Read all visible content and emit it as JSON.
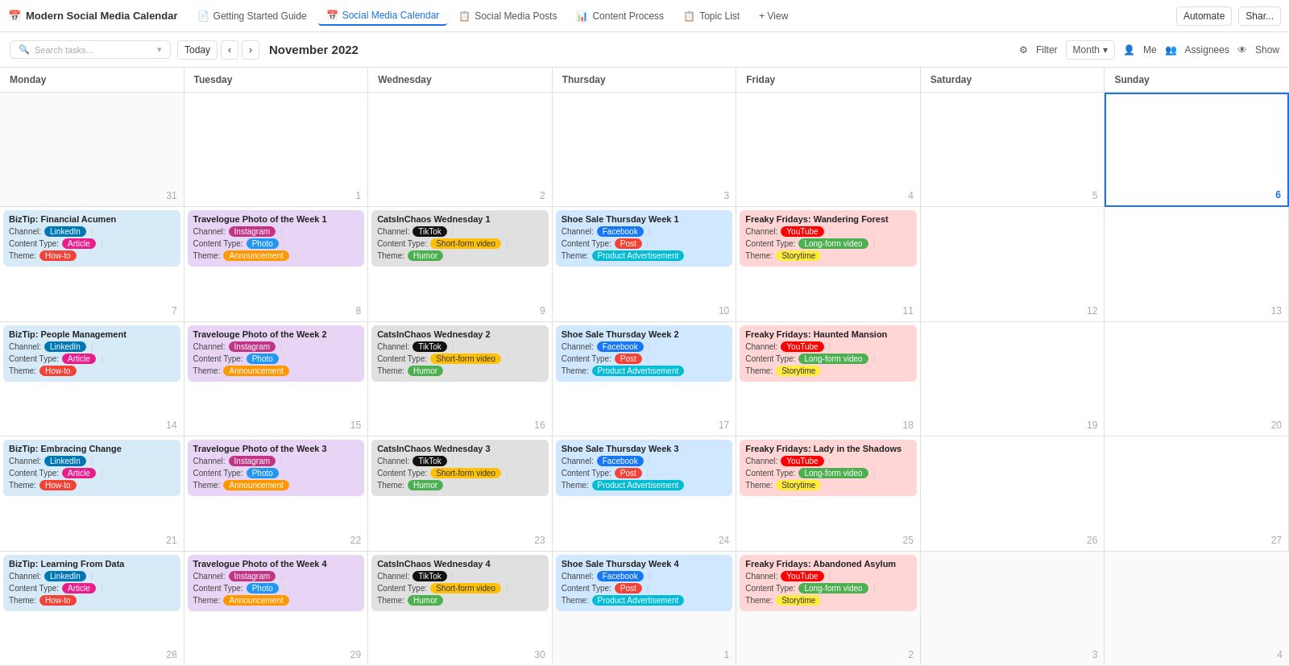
{
  "app": {
    "title": "Modern Social Media Calendar",
    "logo": "📅"
  },
  "nav": {
    "tabs": [
      {
        "id": "getting-started",
        "label": "Getting Started Guide",
        "icon": "📄"
      },
      {
        "id": "social-media-calendar",
        "label": "Social Media Calendar",
        "icon": "📅",
        "active": true
      },
      {
        "id": "social-media-posts",
        "label": "Social Media Posts",
        "icon": "📋"
      },
      {
        "id": "content-process",
        "label": "Content Process",
        "icon": "📊"
      },
      {
        "id": "topic-list",
        "label": "Topic List",
        "icon": "📋"
      }
    ],
    "view": "+ View",
    "automate": "Automate",
    "share": "Shar..."
  },
  "toolbar": {
    "search_placeholder": "Search tasks...",
    "today_btn": "Today",
    "month": "November 2022",
    "filter": "Filter",
    "view_mode": "Month",
    "me": "Me",
    "assignees": "Assignees",
    "show": "Show"
  },
  "calendar": {
    "days": [
      "Monday",
      "Tuesday",
      "Wednesday",
      "Thursday",
      "Friday",
      "Saturday",
      "Sunday"
    ],
    "rows": [
      {
        "cells": [
          {
            "date": "31",
            "other": true,
            "tasks": []
          },
          {
            "date": "1",
            "tasks": []
          },
          {
            "date": "2",
            "tasks": []
          },
          {
            "date": "3",
            "tasks": []
          },
          {
            "date": "4",
            "tasks": []
          },
          {
            "date": "5",
            "tasks": []
          },
          {
            "date": "6",
            "highlight": true,
            "tasks": []
          }
        ]
      },
      {
        "cells": [
          {
            "date": "7",
            "tasks": [
              {
                "title": "BizTip: Financial Acumen",
                "bg": "bg-blue",
                "channel_label": "Channel:",
                "channel_tag": "LinkedIn",
                "channel_class": "linkedin",
                "content_label": "Content Type:",
                "content_tag": "Article",
                "content_class": "article",
                "theme_label": "Theme:",
                "theme_tag": "How-to",
                "theme_class": "howto"
              }
            ]
          },
          {
            "date": "8",
            "tasks": [
              {
                "title": "Travelogue Photo of the Week 1",
                "bg": "bg-purple",
                "channel_label": "Channel:",
                "channel_tag": "Instagram",
                "channel_class": "instagram",
                "content_label": "Content Type:",
                "content_tag": "Photo",
                "content_class": "photo",
                "theme_label": "Theme:",
                "theme_tag": "Announcement",
                "theme_class": "announcement"
              }
            ]
          },
          {
            "date": "9",
            "tasks": [
              {
                "title": "CatsInChaos Wednesday 1",
                "bg": "bg-gray",
                "channel_label": "Channel:",
                "channel_tag": "TikTok",
                "channel_class": "tiktok",
                "content_label": "Content Type:",
                "content_tag": "Short-form video",
                "content_class": "short-video",
                "theme_label": "Theme:",
                "theme_tag": "Humor",
                "theme_class": "humor"
              }
            ]
          },
          {
            "date": "10",
            "tasks": [
              {
                "title": "Shoe Sale Thursday Week 1",
                "bg": "bg-blue2",
                "channel_label": "Channel:",
                "channel_tag": "Facebook",
                "channel_class": "facebook",
                "content_label": "Content Type:",
                "content_tag": "Post",
                "content_class": "post",
                "theme_label": "Theme:",
                "theme_tag": "Product Advertisement",
                "theme_class": "product-ad"
              }
            ]
          },
          {
            "date": "11",
            "tasks": [
              {
                "title": "Freaky Fridays: Wandering Forest",
                "bg": "bg-red",
                "channel_label": "Channel:",
                "channel_tag": "YouTube",
                "channel_class": "youtube",
                "content_label": "Content Type:",
                "content_tag": "Long-form video",
                "content_class": "long-video",
                "theme_label": "Theme:",
                "theme_tag": "Storytime",
                "theme_class": "storytime"
              }
            ]
          },
          {
            "date": "12",
            "tasks": []
          },
          {
            "date": "13",
            "tasks": []
          }
        ]
      },
      {
        "cells": [
          {
            "date": "14",
            "tasks": [
              {
                "title": "BizTip: People Management",
                "bg": "bg-blue",
                "channel_label": "Channel:",
                "channel_tag": "LinkedIn",
                "channel_class": "linkedin",
                "content_label": "Content Type:",
                "content_tag": "Article",
                "content_class": "article",
                "theme_label": "Theme:",
                "theme_tag": "How-to",
                "theme_class": "howto"
              }
            ]
          },
          {
            "date": "15",
            "tasks": [
              {
                "title": "Travelouge Photo of the Week 2",
                "bg": "bg-purple",
                "channel_label": "Channel:",
                "channel_tag": "Instagram",
                "channel_class": "instagram",
                "content_label": "Content Type:",
                "content_tag": "Photo",
                "content_class": "photo",
                "theme_label": "Theme:",
                "theme_tag": "Announcement",
                "theme_class": "announcement"
              }
            ]
          },
          {
            "date": "16",
            "tasks": [
              {
                "title": "CatsInChaos Wednesday 2",
                "bg": "bg-gray",
                "channel_label": "Channel:",
                "channel_tag": "TikTok",
                "channel_class": "tiktok",
                "content_label": "Content Type:",
                "content_tag": "Short-form video",
                "content_class": "short-video",
                "theme_label": "Theme:",
                "theme_tag": "Humor",
                "theme_class": "humor"
              }
            ]
          },
          {
            "date": "17",
            "tasks": [
              {
                "title": "Shoe Sale Thursday Week 2",
                "bg": "bg-blue2",
                "channel_label": "Channel:",
                "channel_tag": "Facebook",
                "channel_class": "facebook",
                "content_label": "Content Type:",
                "content_tag": "Post",
                "content_class": "post",
                "theme_label": "Theme:",
                "theme_tag": "Product Advertisement",
                "theme_class": "product-ad"
              }
            ]
          },
          {
            "date": "18",
            "tasks": [
              {
                "title": "Freaky Fridays: Haunted Mansion",
                "bg": "bg-red",
                "channel_label": "Channel:",
                "channel_tag": "YouTube",
                "channel_class": "youtube",
                "content_label": "Content Type:",
                "content_tag": "Long-form video",
                "content_class": "long-video",
                "theme_label": "Theme:",
                "theme_tag": "Storytime",
                "theme_class": "storytime"
              }
            ]
          },
          {
            "date": "19",
            "tasks": []
          },
          {
            "date": "20",
            "tasks": []
          }
        ]
      },
      {
        "cells": [
          {
            "date": "21",
            "tasks": [
              {
                "title": "BizTip: Embracing Change",
                "bg": "bg-blue",
                "channel_label": "Channel:",
                "channel_tag": "LinkedIn",
                "channel_class": "linkedin",
                "content_label": "Content Type:",
                "content_tag": "Article",
                "content_class": "article",
                "theme_label": "Theme:",
                "theme_tag": "How-to",
                "theme_class": "howto"
              }
            ]
          },
          {
            "date": "22",
            "tasks": [
              {
                "title": "Travelogue Photo of the Week 3",
                "bg": "bg-purple",
                "channel_label": "Channel:",
                "channel_tag": "Instagram",
                "channel_class": "instagram",
                "content_label": "Content Type:",
                "content_tag": "Photo",
                "content_class": "photo",
                "theme_label": "Theme:",
                "theme_tag": "Announcement",
                "theme_class": "announcement"
              }
            ]
          },
          {
            "date": "23",
            "tasks": [
              {
                "title": "CatsInChaos Wednesday 3",
                "bg": "bg-gray",
                "channel_label": "Channel:",
                "channel_tag": "TikTok",
                "channel_class": "tiktok",
                "content_label": "Content Type:",
                "content_tag": "Short-form video",
                "content_class": "short-video",
                "theme_label": "Theme:",
                "theme_tag": "Humor",
                "theme_class": "humor"
              }
            ]
          },
          {
            "date": "24",
            "tasks": [
              {
                "title": "Shoe Sale Thursday Week 3",
                "bg": "bg-blue2",
                "channel_label": "Channel:",
                "channel_tag": "Facebook",
                "channel_class": "facebook",
                "content_label": "Content Type:",
                "content_tag": "Post",
                "content_class": "post",
                "theme_label": "Theme:",
                "theme_tag": "Product Advertisement",
                "theme_class": "product-ad"
              }
            ]
          },
          {
            "date": "25",
            "tasks": [
              {
                "title": "Freaky Fridays: Lady in the Shadows",
                "bg": "bg-red",
                "channel_label": "Channel:",
                "channel_tag": "YouTube",
                "channel_class": "youtube",
                "content_label": "Content Type:",
                "content_tag": "Long-form video",
                "content_class": "long-video",
                "theme_label": "Theme:",
                "theme_tag": "Storytime",
                "theme_class": "storytime"
              }
            ]
          },
          {
            "date": "26",
            "tasks": []
          },
          {
            "date": "27",
            "tasks": []
          }
        ]
      },
      {
        "cells": [
          {
            "date": "28",
            "tasks": [
              {
                "title": "BizTip: Learning From Data",
                "bg": "bg-blue",
                "channel_label": "Channel:",
                "channel_tag": "LinkedIn",
                "channel_class": "linkedin",
                "content_label": "Content Type:",
                "content_tag": "Article",
                "content_class": "article",
                "theme_label": "Theme:",
                "theme_tag": "How-to",
                "theme_class": "howto"
              }
            ]
          },
          {
            "date": "29",
            "tasks": [
              {
                "title": "Travelogue Photo of the Week 4",
                "bg": "bg-purple",
                "channel_label": "Channel:",
                "channel_tag": "Instagram",
                "channel_class": "instagram",
                "content_label": "Content Type:",
                "content_tag": "Photo",
                "content_class": "photo",
                "theme_label": "Theme:",
                "theme_tag": "Announcement",
                "theme_class": "announcement"
              }
            ]
          },
          {
            "date": "30",
            "tasks": [
              {
                "title": "CatsInChaos Wednesday 4",
                "bg": "bg-gray",
                "channel_label": "Channel:",
                "channel_tag": "TikTok",
                "channel_class": "tiktok",
                "content_label": "Content Type:",
                "content_tag": "Short-form video",
                "content_class": "short-video",
                "theme_label": "Theme:",
                "theme_tag": "Humor",
                "theme_class": "humor"
              }
            ]
          },
          {
            "date": "1",
            "other": true,
            "tasks": [
              {
                "title": "Shoe Sale Thursday Week 4",
                "bg": "bg-blue2",
                "channel_label": "Channel:",
                "channel_tag": "Facebook",
                "channel_class": "facebook",
                "content_label": "Content Type:",
                "content_tag": "Post",
                "content_class": "post",
                "theme_label": "Theme:",
                "theme_tag": "Product Advertisement",
                "theme_class": "product-ad"
              }
            ]
          },
          {
            "date": "2",
            "other": true,
            "tasks": [
              {
                "title": "Freaky Fridays: Abandoned Asylum",
                "bg": "bg-red",
                "channel_label": "Channel:",
                "channel_tag": "YouTube",
                "channel_class": "youtube",
                "content_label": "Content Type:",
                "content_tag": "Long-form video",
                "content_class": "long-video",
                "theme_label": "Theme:",
                "theme_tag": "Storytime",
                "theme_class": "storytime"
              }
            ]
          },
          {
            "date": "3",
            "other": true,
            "tasks": []
          },
          {
            "date": "4",
            "other": true,
            "tasks": []
          }
        ]
      }
    ]
  }
}
